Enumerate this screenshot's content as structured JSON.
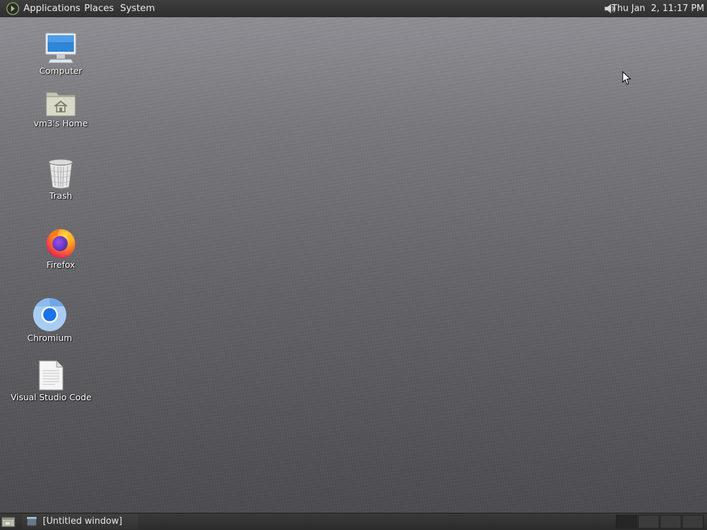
{
  "top_panel": {
    "menus": [
      "Applications",
      "Places",
      "System"
    ],
    "clock": "Thu Jan  2, 11:17 PM",
    "icons": {
      "logo": "gnome-foot-icon",
      "volume": "speaker-icon"
    }
  },
  "desktop": {
    "icons": [
      {
        "label": "Computer",
        "icon": "computer-monitor-icon"
      },
      {
        "label": "vm3's Home",
        "icon": "home-folder-icon"
      },
      {
        "label": "Trash",
        "icon": "trash-icon"
      },
      {
        "label": "Firefox",
        "icon": "firefox-icon"
      },
      {
        "label": "Chromium",
        "icon": "chromium-icon"
      },
      {
        "label": "Visual Studio Code",
        "icon": "text-document-icon"
      }
    ]
  },
  "bottom_panel": {
    "show_desktop_icon": "show-desktop-icon",
    "task": {
      "label": "[Untitled window]",
      "icon": "window-icon"
    },
    "workspaces": 4,
    "active_workspace": 1
  },
  "colors": {
    "panel": "#333333",
    "panel_text": "#ececec",
    "desktop_top": "#8d8d93",
    "desktop_bottom": "#4b4b4f"
  }
}
